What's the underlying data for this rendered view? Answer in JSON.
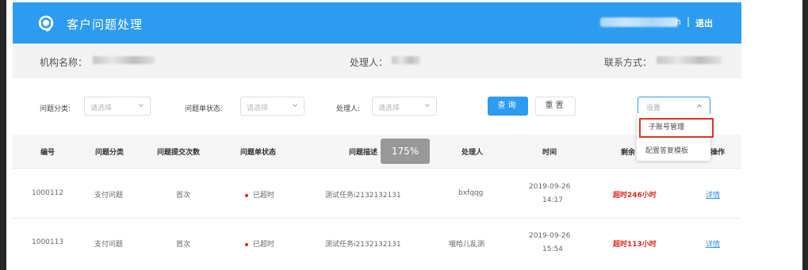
{
  "app": {
    "title": "客户问题处理",
    "user_suffix": "n",
    "separator": "|",
    "logout": "退出"
  },
  "info": {
    "org_label": "机构名称：",
    "handler_label": "处理人：",
    "contact_label": "联系方式："
  },
  "filters": [
    {
      "label": "问题分类:",
      "placeholder": "请选择"
    },
    {
      "label": "问题单状态:",
      "placeholder": "请选择"
    },
    {
      "label": "处理人:",
      "placeholder": "请选择"
    }
  ],
  "buttons": {
    "query": "查询",
    "reset": "重置"
  },
  "settings": {
    "placeholder": "设置",
    "menu": [
      "子账号管理",
      "配置答复模板"
    ]
  },
  "table": {
    "headers": [
      "编号",
      "问题分类",
      "问题提交次数",
      "问题单状态",
      "问题描述",
      "处理人",
      "时间",
      "剩余",
      "操作"
    ],
    "rows": [
      {
        "id": "1000112",
        "category": "支付问题",
        "count": "首次",
        "status": "已超时",
        "desc": "测试任务i2132132131",
        "handler": "bxfqqg",
        "date": "2019-09-26",
        "time": "14:17",
        "remain": "超时246小时",
        "action": "详情"
      },
      {
        "id": "1000113",
        "category": "支付问题",
        "count": "首次",
        "status": "已超时",
        "desc": "测试任务i2132132131",
        "handler": "哦哈儿乱测",
        "date": "2019-09-26",
        "time": "15:54",
        "remain": "超时113小时",
        "action": "详情"
      }
    ]
  },
  "zoom": "175%",
  "colors": {
    "primary": "#2d9cf0",
    "danger": "#e0271f",
    "highlight": "#d9342b"
  }
}
